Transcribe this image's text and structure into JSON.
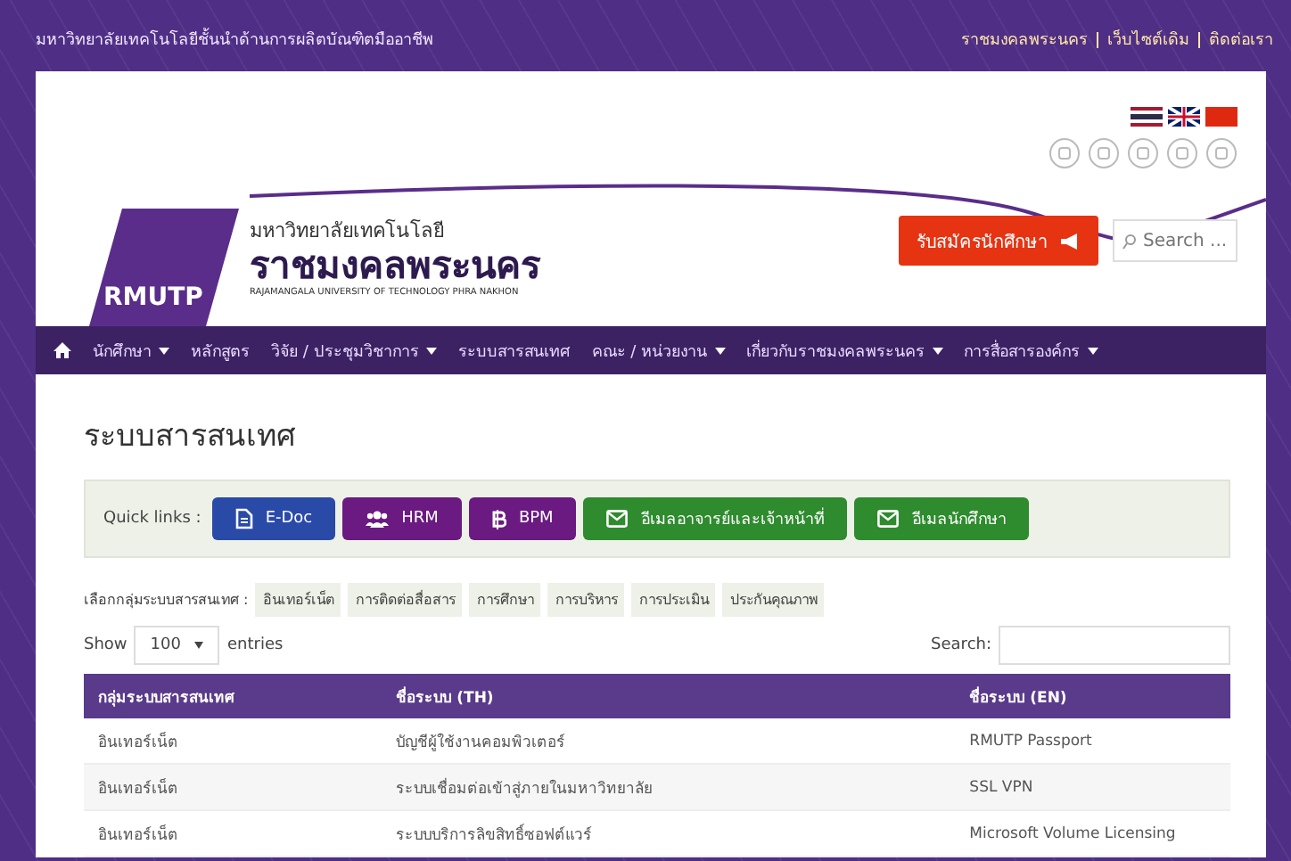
{
  "top_bar": {
    "tagline": "มหาวิทยาลัยเทคโนโลยีชั้นนำด้านการผลิตบัณฑิตมืออาชีพ",
    "links": [
      "ราชมงคลพระนคร",
      "เว็บไซต์เดิม",
      "ติดต่อเรา"
    ]
  },
  "header": {
    "logo_text": "RMUTP",
    "name_small": "มหาวิทยาลัยเทคโนโลยี",
    "name_large": "ราชมงคลพระนคร",
    "name_en": "RAJAMANGALA UNIVERSITY OF TECHNOLOGY PHRA NAKHON",
    "apply_button": "รับสมัครนักศึกษา",
    "search": {
      "placeholder": "Search ..."
    }
  },
  "nav": [
    {
      "label": "นักศึกษา",
      "dropdown": true
    },
    {
      "label": "หลักสูตร",
      "dropdown": false
    },
    {
      "label": "วิจัย / ประชุมวิชาการ",
      "dropdown": true
    },
    {
      "label": "ระบบสารสนเทศ",
      "dropdown": false
    },
    {
      "label": "คณะ / หน่วยงาน",
      "dropdown": true
    },
    {
      "label": "เกี่ยวกับราชมงคลพระนคร",
      "dropdown": true
    },
    {
      "label": "การสื่อสารองค์กร",
      "dropdown": true
    }
  ],
  "page_title": "ระบบสารสนเทศ",
  "quick_links": {
    "label": "Quick links :",
    "items": [
      {
        "label": "E-Doc",
        "kind": "document",
        "color": "#2a4aa8"
      },
      {
        "label": "HRM",
        "kind": "users",
        "color": "#6a1a80"
      },
      {
        "label": "BPM",
        "kind": "bitcoin",
        "color": "#6a1a80"
      },
      {
        "label": "อีเมลอาจารย์และเจ้าหน้าที่",
        "kind": "mail",
        "color": "#2e8b2e"
      },
      {
        "label": "อีเมลนักศึกษา",
        "kind": "mail",
        "color": "#2e8b2e"
      }
    ]
  },
  "group_filter": {
    "label": "เลือกกลุ่มระบบสารสนเทศ :",
    "items": [
      "อินเทอร์เน็ต",
      "การติดต่อสื่อสาร",
      "การศึกษา",
      "การบริหาร",
      "การประเมิน",
      "ประกันคุณภาพ"
    ]
  },
  "table_controls": {
    "show_label": "Show",
    "page_size": "100",
    "entries_label": "entries",
    "search_label": "Search:"
  },
  "table": {
    "columns": [
      "กลุ่มระบบสารสนเทศ",
      "ชื่อระบบ (TH)",
      "ชื่อระบบ (EN)"
    ],
    "rows": [
      [
        "อินเทอร์เน็ต",
        "บัญชีผู้ใช้งานคอมพิวเตอร์",
        "RMUTP Passport"
      ],
      [
        "อินเทอร์เน็ต",
        "ระบบเชื่อมต่อเข้าสู่ภายในมหาวิทยาลัย",
        "SSL VPN"
      ],
      [
        "อินเทอร์เน็ต",
        "ระบบบริการลิขสิทธิ์ซอฟต์แวร์",
        "Microsoft Volume Licensing"
      ]
    ]
  }
}
